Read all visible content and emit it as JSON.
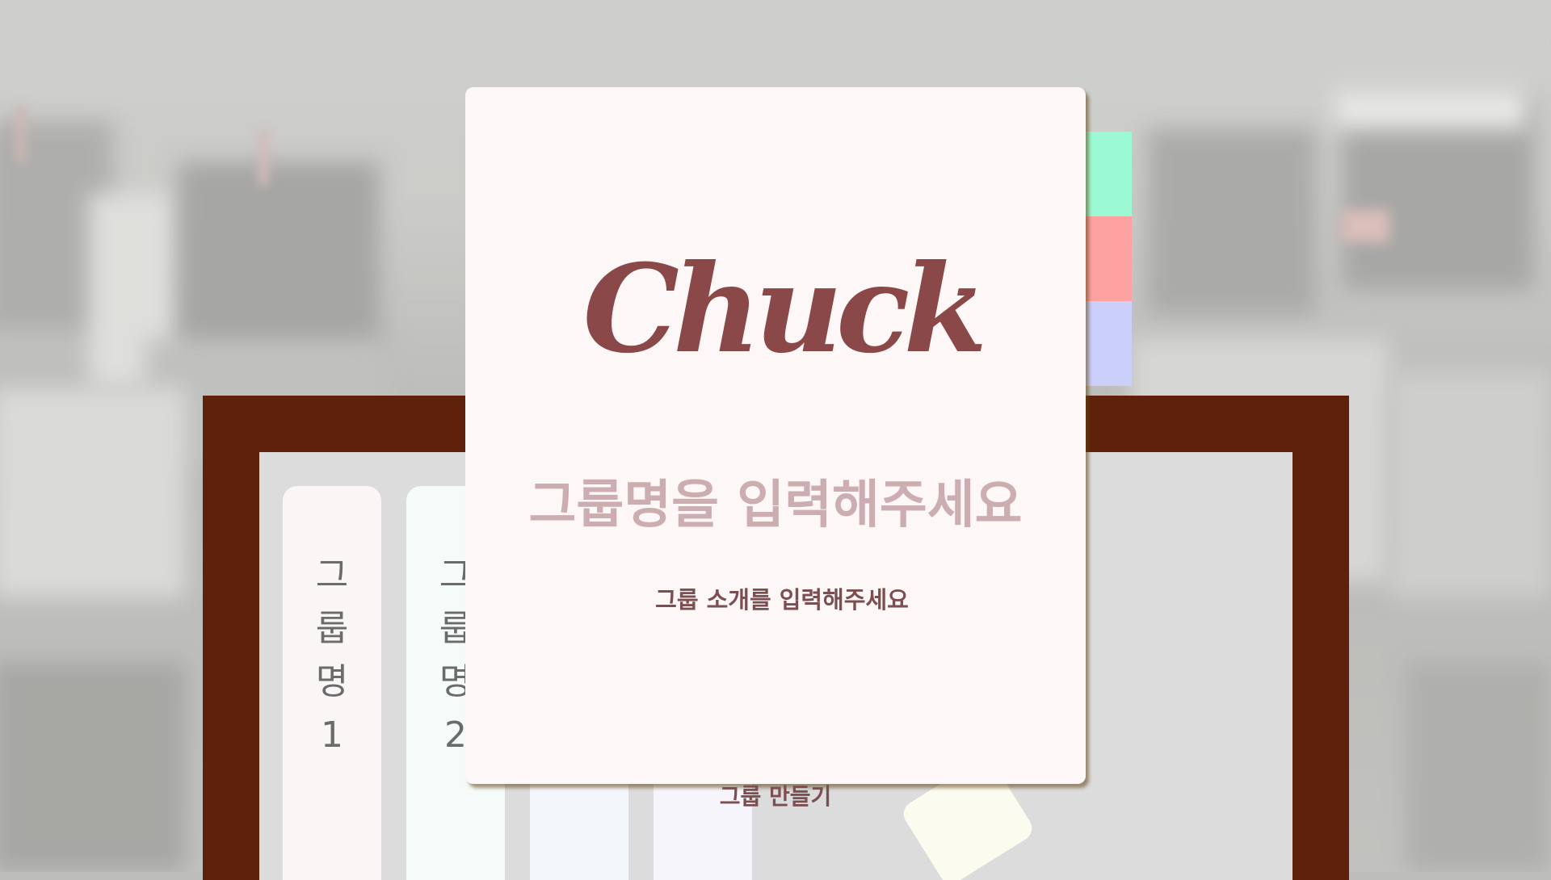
{
  "background": {
    "description_color": "#c3c3c1"
  },
  "bookshelf": {
    "frame_color": "#5e210b",
    "inner_color": "#dcdcdc",
    "books": [
      {
        "title": "그룹명1",
        "color": "#fbf6f6"
      },
      {
        "title": "그룹명2",
        "color": "#f5fbf8"
      },
      {
        "title": "",
        "color": "#f3f7fb"
      },
      {
        "title": "",
        "color": "#f5f5fb"
      }
    ],
    "note_color": "#fbfbf0"
  },
  "color_tabs": [
    "#9bfad3",
    "#fda1a1",
    "#cbd0fb"
  ],
  "modal": {
    "logo": "Chuck",
    "logo_color": "#8a4948",
    "group_name_placeholder": "그룹명을 입력해주세요",
    "group_intro_placeholder": "그룹 소개를 입력해주세요",
    "create_button": "그룹 만들기",
    "background_color": "#fdf7f7"
  }
}
